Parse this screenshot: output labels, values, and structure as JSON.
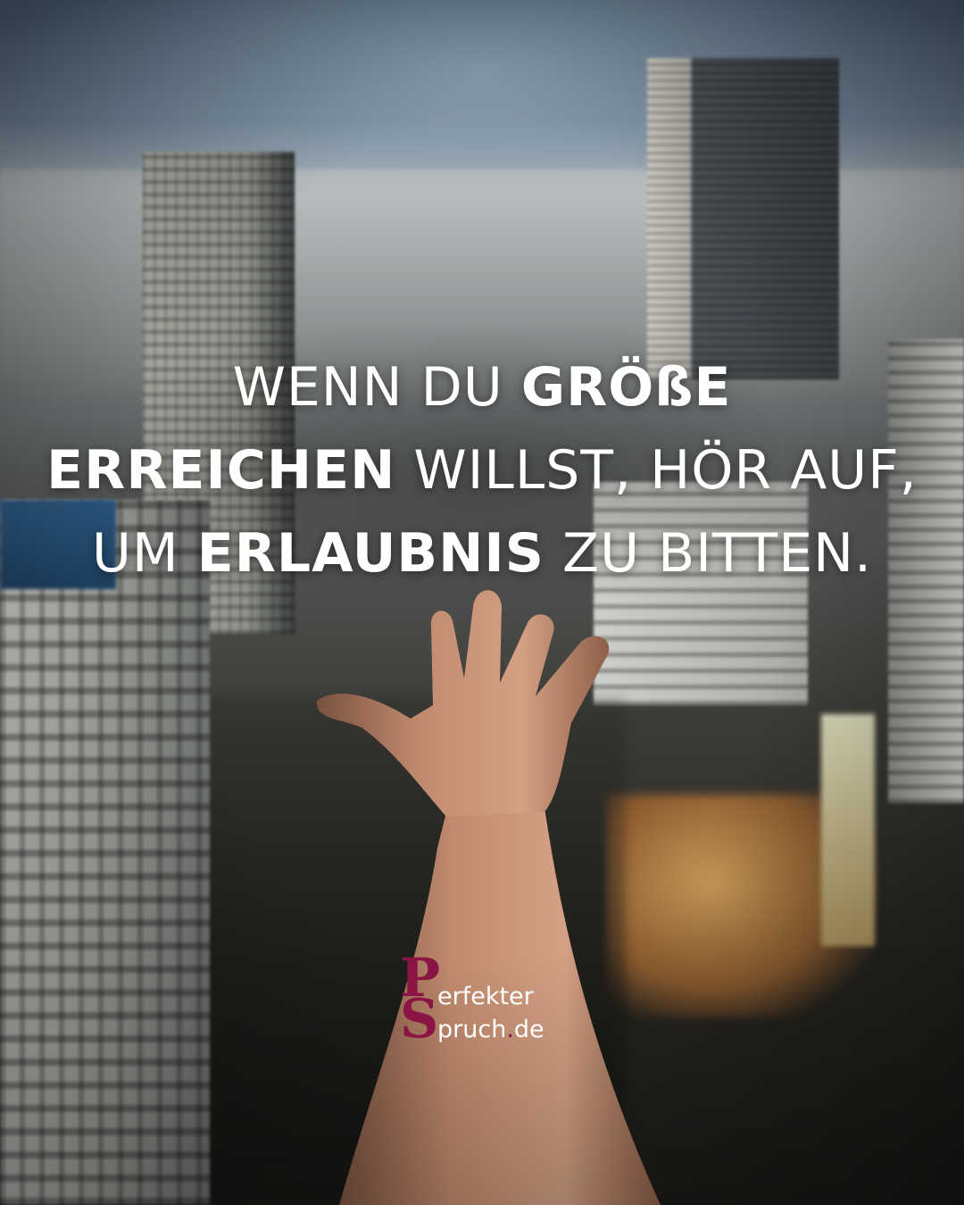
{
  "quote": {
    "line1_regular": "WENN DU ",
    "line1_bold": "GRÖßE",
    "line2_bold": "ERREICHEN",
    "line2_regular": " WILLST, HÖR AUF,",
    "line3_regular_a": "UM ",
    "line3_bold": "ERLAUBNIS",
    "line3_regular_b": " ZU BITTEN."
  },
  "logo": {
    "mono_p": "P",
    "mono_s": "S",
    "line1": "erfekter",
    "line2": "pruch",
    "dot": ".",
    "tld": "de",
    "accent_color": "#8a1545"
  }
}
